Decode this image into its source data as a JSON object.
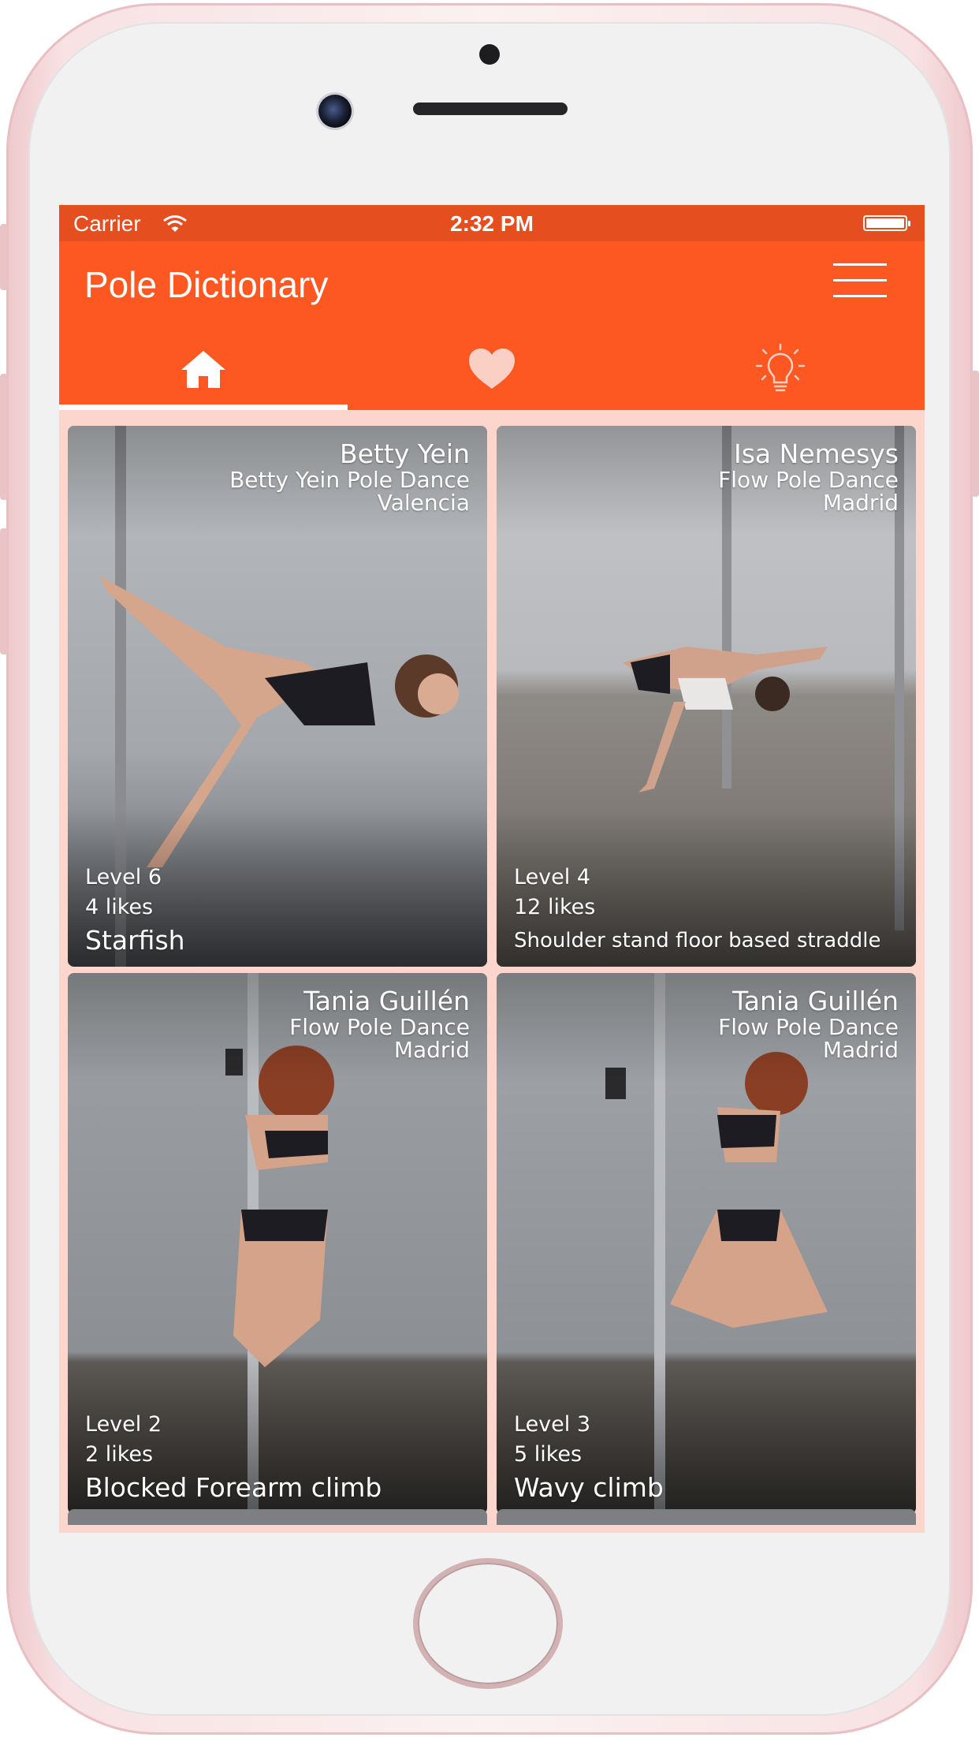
{
  "status_bar": {
    "carrier": "Carrier",
    "time": "2:32 PM"
  },
  "app": {
    "title": "Pole Dictionary"
  },
  "tabs": [
    {
      "icon": "home-icon",
      "active": true
    },
    {
      "icon": "heart-icon",
      "active": false
    },
    {
      "icon": "lightbulb-icon",
      "active": false
    }
  ],
  "colors": {
    "accent": "#fd5722",
    "status_bar": "#e54f1f",
    "background": "#fcd5cc"
  },
  "cards": [
    {
      "name": "Betty Yein",
      "studio": "Betty Yein Pole Dance",
      "city": "Valencia",
      "level": "Level 6",
      "likes": "4 likes",
      "move": "Starfish"
    },
    {
      "name": "Isa Nemesys",
      "studio": "Flow Pole Dance",
      "city": "Madrid",
      "level": "Level 4",
      "likes": "12 likes",
      "move": "Shoulder stand floor based straddle"
    },
    {
      "name": "Tania Guillén",
      "studio": "Flow Pole Dance",
      "city": "Madrid",
      "level": "Level 2",
      "likes": "2 likes",
      "move": "Blocked Forearm climb"
    },
    {
      "name": "Tania Guillén",
      "studio": "Flow Pole Dance",
      "city": "Madrid",
      "level": "Level 3",
      "likes": "5 likes",
      "move": "Wavy climb"
    }
  ]
}
